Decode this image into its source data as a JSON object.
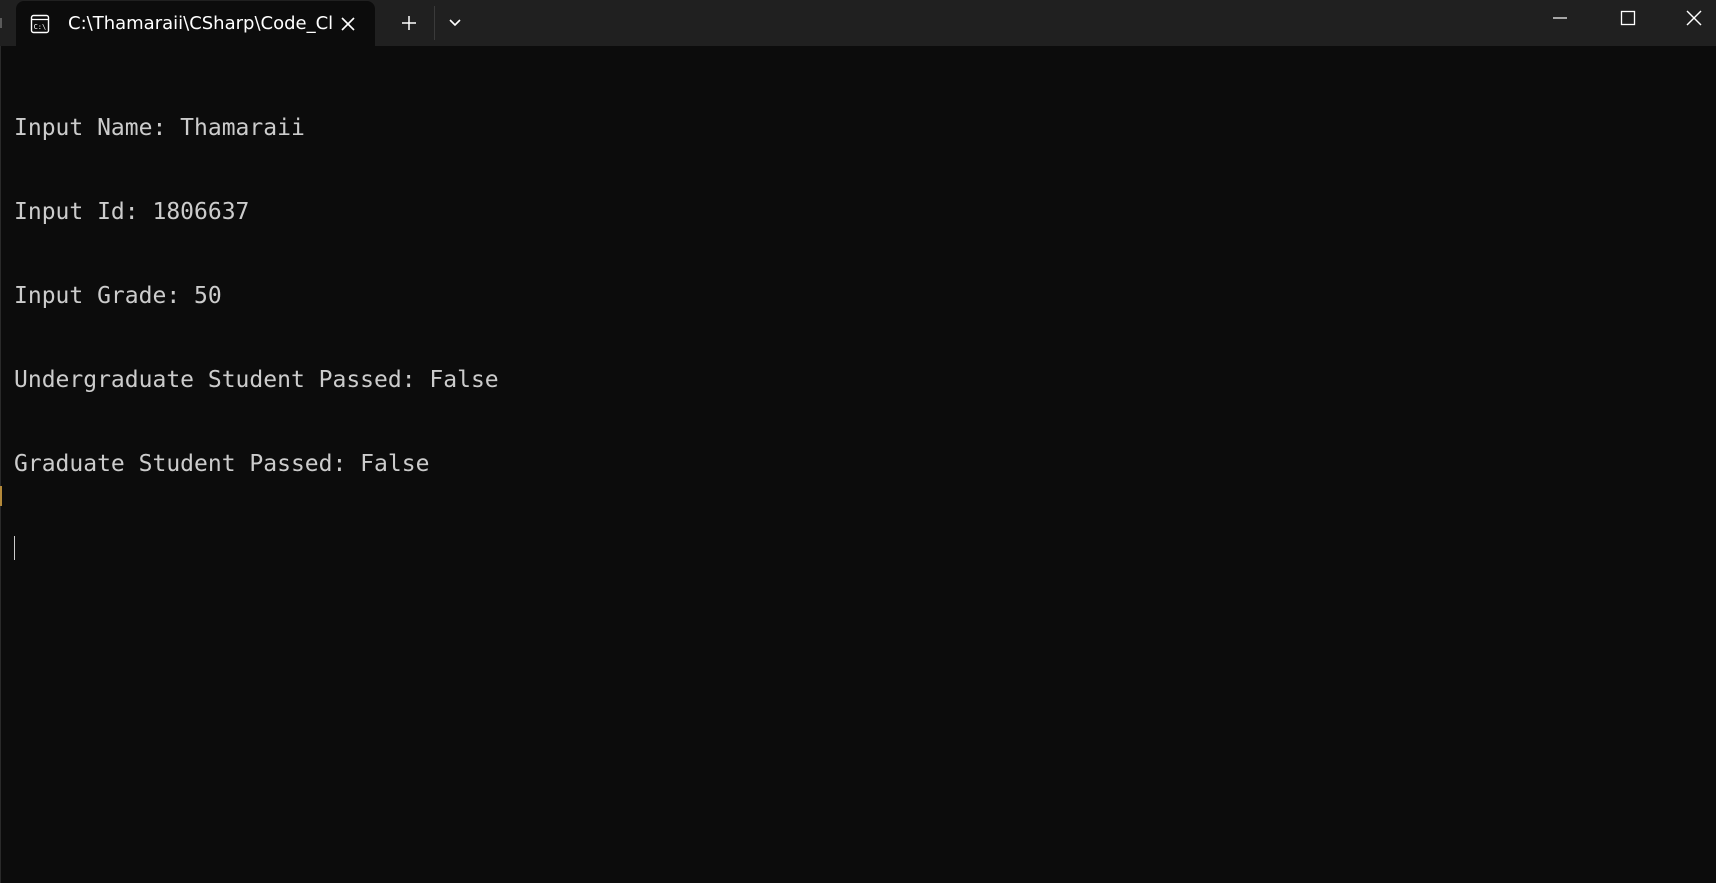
{
  "tab": {
    "title": "C:\\Thamaraii\\CSharp\\Code_Cl",
    "icon": "terminal-icon"
  },
  "titlebar_icons": {
    "close_tab": "close-icon",
    "new_tab": "plus-icon",
    "dropdown": "chevron-down-icon",
    "minimize": "minimize-icon",
    "maximize": "maximize-icon",
    "close_window": "close-icon"
  },
  "terminal": {
    "lines": [
      "Input Name: Thamaraii",
      "Input Id: 1806637",
      "Input Grade: 50",
      "Undergraduate Student Passed: False",
      "Graduate Student Passed: False"
    ]
  },
  "colors": {
    "background": "#0c0c0c",
    "titlebar": "#202020",
    "text": "#cccccc"
  }
}
